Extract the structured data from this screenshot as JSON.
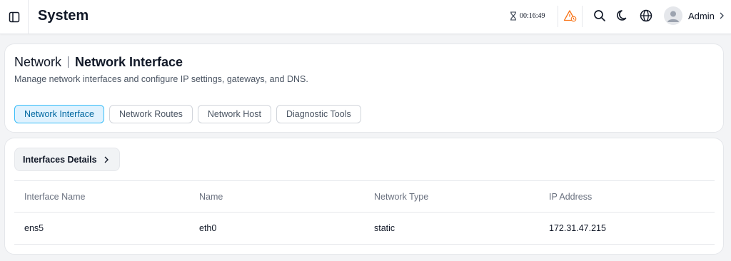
{
  "app": {
    "title": "System"
  },
  "topbar": {
    "timer": "00:16:49",
    "user": {
      "name": "Admin"
    },
    "icons": [
      "sidebar-toggle-icon",
      "hourglass-icon",
      "alert-triangle-icon",
      "search-icon",
      "moon-icon",
      "globe-icon",
      "user-avatar-icon",
      "chevron-right-icon"
    ]
  },
  "header": {
    "breadcrumb_parent": "Network",
    "breadcrumb_current": "Network Interface",
    "subtitle": "Manage network interfaces and configure IP settings, gateways, and DNS."
  },
  "tabs": [
    {
      "label": "Network Interface",
      "active": true
    },
    {
      "label": "Network Routes",
      "active": false
    },
    {
      "label": "Network Host",
      "active": false
    },
    {
      "label": "Diagnostic Tools",
      "active": false
    }
  ],
  "details": {
    "section_label": "Interfaces Details",
    "columns": [
      "Interface Name",
      "Name",
      "Network Type",
      "IP Address"
    ],
    "rows": [
      [
        "ens5",
        "eth0",
        "static",
        "172.31.47.215"
      ]
    ]
  },
  "colors": {
    "accent": "#0369a1",
    "accent_bg": "#e0f2fe",
    "accent_border": "#38bdf8",
    "warning": "#f97316",
    "background": "#f3f4f6"
  }
}
